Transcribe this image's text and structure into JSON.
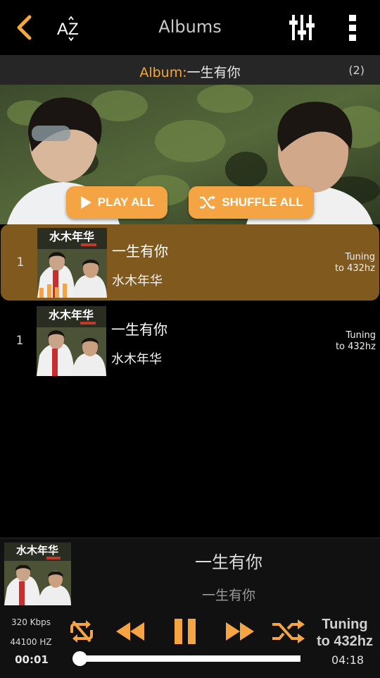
{
  "header": {
    "title": "Albums",
    "icons": [
      "back-chevron-icon",
      "sort-az-icon",
      "equalizer-icon",
      "more-vert-icon"
    ],
    "sort_label": "AZ"
  },
  "album_bar": {
    "key": "Album:",
    "name": "一生有你",
    "count": "(2)"
  },
  "hero": {
    "play_all_label": "PLAY ALL",
    "shuffle_all_label": "SHUFFLE ALL"
  },
  "tracks": [
    {
      "number": "1",
      "title": "一生有你",
      "artist": "水木年华",
      "tuning": "Tuning to 432hz",
      "cover_text": "水木年华",
      "active": true
    },
    {
      "number": "1",
      "title": "一生有你",
      "artist": "水木年华",
      "tuning": "Tuning to 432hz",
      "cover_text": "水木年华",
      "active": false
    }
  ],
  "now_playing": {
    "title": "一生有你",
    "artist": "一生有你",
    "cover_text": "水木年华",
    "bitrate": "320 Kbps",
    "sample_rate": "44100 HZ",
    "elapsed": "00:01",
    "duration": "04:18",
    "tuning": "Tuning to 432hz",
    "progress": 0.0
  },
  "colors": {
    "accent": "#f4a73a",
    "active_row": "#80591f",
    "button": "#f5a444"
  }
}
